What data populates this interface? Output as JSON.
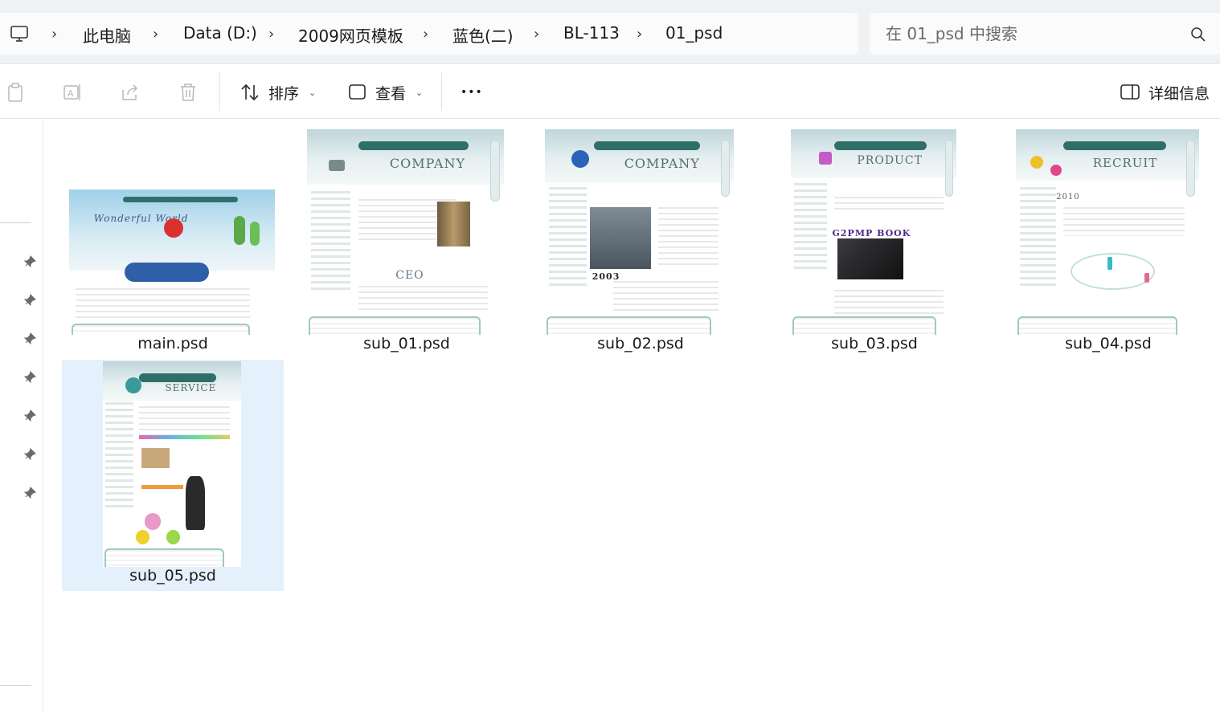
{
  "breadcrumb": {
    "items": [
      "此电脑",
      "Data (D:)",
      "2009网页模板",
      "蓝色(二)",
      "BL-113",
      "01_psd"
    ]
  },
  "search": {
    "placeholder": "在 01_psd 中搜索"
  },
  "toolbar": {
    "sort_label": "排序",
    "view_label": "查看",
    "more_label": "•••",
    "details_label": "详细信息"
  },
  "files": [
    {
      "name": "main.psd",
      "thumb_title": "Wonderful World",
      "selected": false
    },
    {
      "name": "sub_01.psd",
      "thumb_title": "COMPANY",
      "thumb_sub": "CEO",
      "selected": false
    },
    {
      "name": "sub_02.psd",
      "thumb_title": "COMPANY",
      "thumb_sub": "2003",
      "selected": false
    },
    {
      "name": "sub_03.psd",
      "thumb_title": "PRODUCT",
      "thumb_sub": "G2PMP BOOK",
      "selected": false
    },
    {
      "name": "sub_04.psd",
      "thumb_title": "RECRUIT",
      "thumb_sub": "2010",
      "selected": false
    },
    {
      "name": "sub_05.psd",
      "thumb_title": "SERVICE",
      "selected": true
    }
  ],
  "colors": {
    "selection": "#e4f0fb",
    "address_bg": "#eef2f5",
    "thumb_green": "#2f6f6a"
  }
}
